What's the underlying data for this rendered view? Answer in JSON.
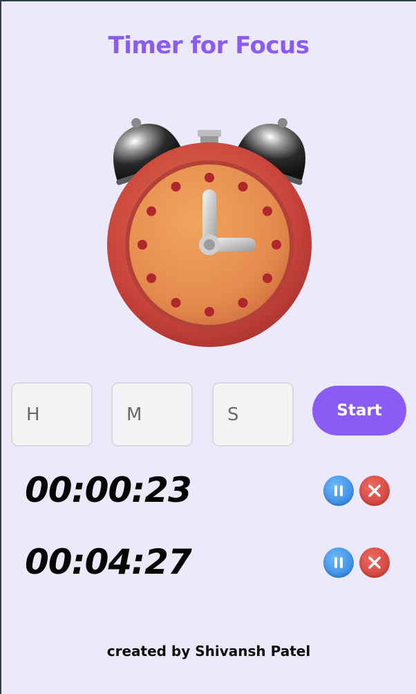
{
  "app": {
    "title": "Timer for Focus",
    "accent_color": "#8a5cf5",
    "background_color": "#ece9fb"
  },
  "illustration": {
    "icon": "alarm-clock-icon"
  },
  "inputs": {
    "hours_placeholder": "H",
    "minutes_placeholder": "M",
    "seconds_placeholder": "S",
    "start_label": "Start"
  },
  "timers": [
    {
      "time": "00:00:23",
      "pause_icon": "pause-icon",
      "remove_icon": "close-icon"
    },
    {
      "time": "00:04:27",
      "pause_icon": "pause-icon",
      "remove_icon": "close-icon"
    }
  ],
  "footer": {
    "credit": "created by Shivansh Patel"
  }
}
